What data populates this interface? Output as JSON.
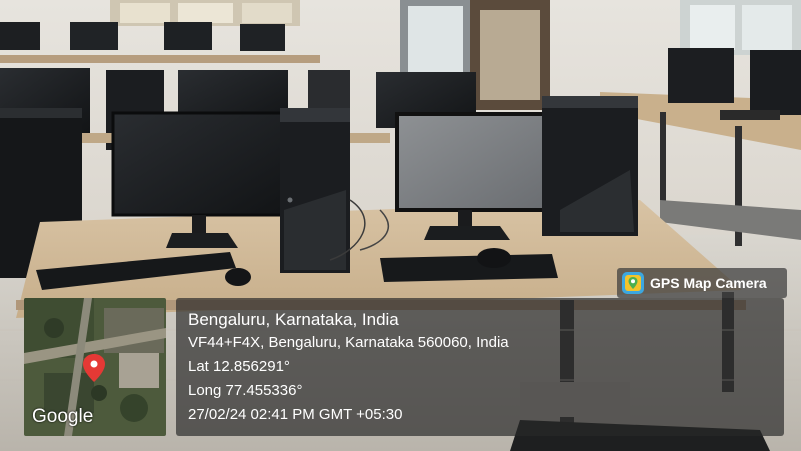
{
  "badge": {
    "label": "GPS Map Camera",
    "icon": "gps-map-camera-icon"
  },
  "map": {
    "provider_label": "Google",
    "pin_color": "#e53935"
  },
  "location": {
    "city_line": "Bengaluru, Karnataka, India",
    "address_line": "VF44+F4X, Bengaluru, Karnataka 560060, India",
    "lat_line": "Lat 12.856291°",
    "long_line": "Long 77.455336°",
    "datetime_line": "27/02/24 02:41 PM GMT +05:30"
  }
}
